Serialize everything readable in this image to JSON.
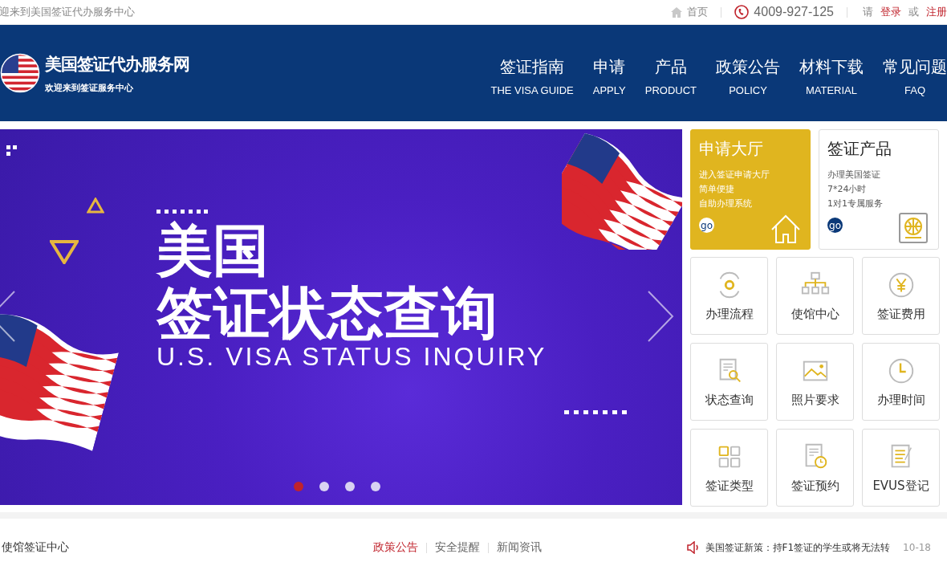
{
  "top_bar": {
    "welcome": "迎来到美国签证代办服务中心",
    "home": "首页",
    "phone": "4009-927-125",
    "prompt": "请",
    "login": "登录",
    "or": "或",
    "register": "注册"
  },
  "header": {
    "site_name": "美国签证代办服务网",
    "tagline": "欢迎来到签证服务中心",
    "nav": [
      {
        "label": "签证指南",
        "sub": "THE VISA GUIDE"
      },
      {
        "label": "申请",
        "sub": "APPLY"
      },
      {
        "label": "产品",
        "sub": "PRODUCT"
      },
      {
        "label": "政策公告",
        "sub": "POLICY"
      },
      {
        "label": "材料下载",
        "sub": "MATERIAL"
      },
      {
        "label": "常见问题",
        "sub": "FAQ"
      }
    ]
  },
  "banner": {
    "title_line_1": "美国",
    "title_line_2": "签证状态查询",
    "subtitle": "U.S. VISA STATUS INQUIRY",
    "dots": [
      {
        "selected": true
      },
      {
        "selected": false
      },
      {
        "selected": false
      },
      {
        "selected": false
      }
    ]
  },
  "feature_cards": [
    {
      "kind": "highlight",
      "title": "申请大厅",
      "lines": [
        "进入签证申请大厅",
        "简单便捷",
        "自助办理系统"
      ],
      "go": "go"
    },
    {
      "kind": "plain",
      "title": "签证产品",
      "lines": [
        "办理美国签证",
        "7*24小时",
        "1对1专属服务"
      ],
      "go": "go"
    }
  ],
  "tiles": [
    {
      "label": "办理流程"
    },
    {
      "label": "使馆中心"
    },
    {
      "label": "签证费用"
    },
    {
      "label": "状态查询"
    },
    {
      "label": "照片要求"
    },
    {
      "label": "办理时间"
    },
    {
      "label": "签证类型"
    },
    {
      "label": "签证预约"
    },
    {
      "label": "EVUS登记"
    }
  ],
  "news": {
    "section_title": "使馆签证中心",
    "tabs": [
      {
        "label": "政策公告",
        "selected": true
      },
      {
        "label": "安全提醒",
        "selected": false
      },
      {
        "label": "新闻资讯",
        "selected": false
      }
    ],
    "headline": "美国签证新策：持F1签证的学生或将无法转",
    "date": "10-18"
  }
}
